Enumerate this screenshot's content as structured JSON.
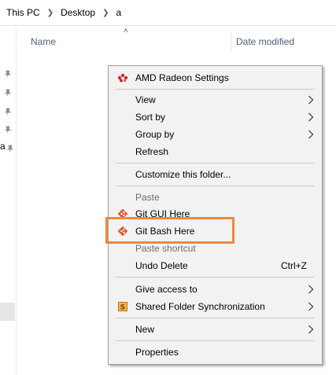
{
  "address_bar": {
    "crumbs": [
      "This PC",
      "Desktop",
      "a"
    ]
  },
  "columns": {
    "name": "Name",
    "date_modified": "Date modified"
  },
  "nav": {
    "partial_label": "a"
  },
  "context_menu": {
    "amd": "AMD Radeon Settings",
    "view": "View",
    "sort_by": "Sort by",
    "group_by": "Group by",
    "refresh": "Refresh",
    "customize": "Customize this folder...",
    "paste": "Paste",
    "git_gui": "Git GUI Here",
    "git_bash": "Git Bash Here",
    "paste_shortcut": "Paste shortcut",
    "undo_delete": "Undo Delete",
    "undo_shortcut": "Ctrl+Z",
    "give_access": "Give access to",
    "shared_folder": "Shared Folder Synchronization",
    "new": "New",
    "properties": "Properties"
  },
  "colors": {
    "highlight": "#f0883a",
    "menu_bg": "#f2f2f2",
    "git_icon": "#e8563a",
    "amd_icon": "#d0282e"
  },
  "icons": {
    "amd": "amd-radeon-icon",
    "git": "git-icon",
    "shared_folder": "shared-folder-icon",
    "pin": "pin-icon",
    "submenu": "chevron-right-icon"
  }
}
